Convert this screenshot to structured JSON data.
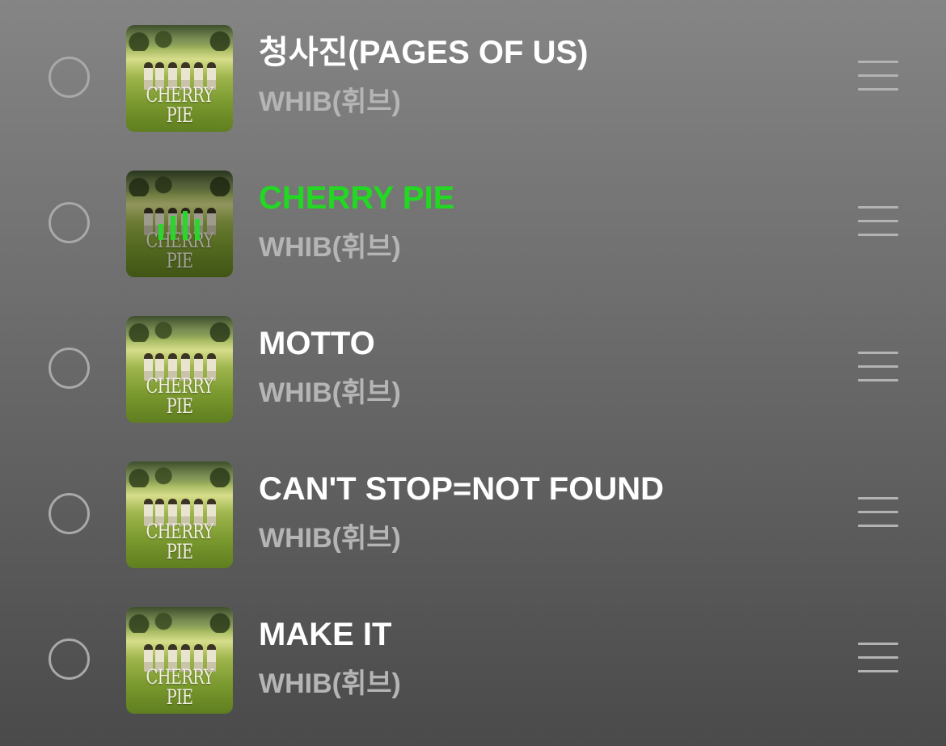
{
  "colors": {
    "active_title": "#22d822",
    "title": "#ffffff",
    "artist": "#b5b5b5",
    "icon": "#a9a9a9"
  },
  "album": {
    "art_text": "CHERRY PIE"
  },
  "tracks": [
    {
      "title": "청사진(PAGES OF US)",
      "artist": "WHIB(휘브)",
      "playing": false,
      "selected": false,
      "icon": "drag-handle-icon"
    },
    {
      "title": "CHERRY PIE",
      "artist": "WHIB(휘브)",
      "playing": true,
      "selected": false,
      "icon": "drag-handle-icon",
      "status_icon": "equalizer-icon"
    },
    {
      "title": "MOTTO",
      "artist": "WHIB(휘브)",
      "playing": false,
      "selected": false,
      "icon": "drag-handle-icon"
    },
    {
      "title": "CAN'T STOP=NOT FOUND",
      "artist": "WHIB(휘브)",
      "playing": false,
      "selected": false,
      "icon": "drag-handle-icon"
    },
    {
      "title": "MAKE IT",
      "artist": "WHIB(휘브)",
      "playing": false,
      "selected": false,
      "icon": "drag-handle-icon"
    }
  ]
}
